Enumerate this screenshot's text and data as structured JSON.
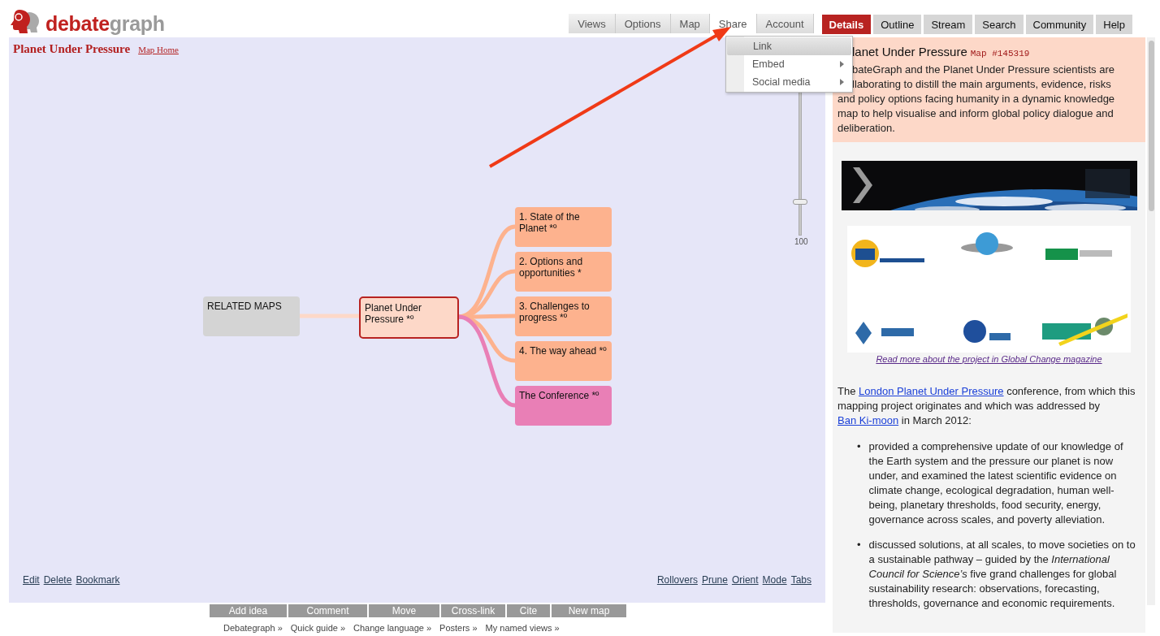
{
  "logo": {
    "part_1": "debate",
    "part_2": "graph"
  },
  "nav_tabs": [
    {
      "label": "Views",
      "selected": false
    },
    {
      "label": "Options",
      "selected": false
    },
    {
      "label": "Map",
      "selected": false
    },
    {
      "label": "Share",
      "selected": true
    },
    {
      "label": "Account",
      "selected": false
    }
  ],
  "panel_tabs": [
    {
      "label": "Details",
      "selected": true
    },
    {
      "label": "Outline",
      "selected": false
    },
    {
      "label": "Stream",
      "selected": false
    },
    {
      "label": "Search",
      "selected": false
    },
    {
      "label": "Community",
      "selected": false
    },
    {
      "label": "Help",
      "selected": false
    }
  ],
  "share_menu": {
    "items": [
      {
        "label": "Link",
        "highlighted": true,
        "submenu": false
      },
      {
        "label": "Embed",
        "highlighted": false,
        "submenu": true
      },
      {
        "label": "Social media",
        "highlighted": false,
        "submenu": true
      }
    ]
  },
  "map": {
    "title": "Planet Under Pressure",
    "home_link": "Map Home",
    "zoom": {
      "level": 0.18,
      "reading": "100"
    },
    "related": {
      "label": "RELATED MAPS"
    },
    "center": {
      "label": "Planet Under Pressure *º"
    },
    "children": [
      {
        "label": "1. State of the Planet *º",
        "color": "#fdb28e"
      },
      {
        "label": "2. Options and opportunities *",
        "color": "#fdb28e"
      },
      {
        "label": "3. Challenges to progress *º",
        "color": "#fdb28e"
      },
      {
        "label": "4. The way ahead *º",
        "color": "#fdb28e"
      },
      {
        "label": "The Conference *º",
        "color": "#e97fb6"
      }
    ],
    "left_links": [
      "Edit",
      "Delete",
      "Bookmark"
    ],
    "right_links": [
      "Rollovers",
      "Prune",
      "Orient",
      "Mode",
      "Tabs"
    ]
  },
  "actions": [
    "Add idea",
    "Comment",
    "Move",
    "Cross-link",
    "Cite",
    "New map"
  ],
  "footer_links": [
    "Debategraph »",
    "Quick guide »",
    "Change language »",
    "Posters »",
    "My named views »"
  ],
  "details": {
    "title": "lanet Under Pressure",
    "map_id": "Map #145319",
    "summary_lines": [
      "bateGraph and the Planet Under Pressure scientists are",
      "llaborating to distill the main arguments, evidence, risks",
      "and policy options facing humanity in a dynamic knowledge",
      "map to help visualise and inform global policy dialogue and",
      "deliberation."
    ],
    "magazine_link": "Read more about the project in Global Change magazine",
    "intro": [
      {
        "kind": "text",
        "text": "The "
      },
      {
        "kind": "link",
        "text": "London Planet Under Pressure"
      },
      {
        "kind": "text",
        "text": " conference, from which this mapping project originates and which was addressed by "
      },
      {
        "kind": "link",
        "text": "Ban Ki-moon"
      },
      {
        "kind": "text",
        "text": " in March 2012:"
      }
    ],
    "bullets": [
      {
        "marker": "•",
        "text": "provided a comprehensive update of our knowledge of the Earth system and the pressure our planet is now under, and examined the latest scientific evidence on climate change, ecological degradation, human well-being, planetary thresholds, food security, energy, governance across scales, and poverty alleviation."
      },
      {
        "marker": "•",
        "text": "discussed solutions, at all scales, to move societies on to a sustainable pathway – guided by the *International Council for Science’s* five grand challenges for global sustainability research: observations, forecasting, thresholds, governance and economic requirements."
      }
    ]
  }
}
